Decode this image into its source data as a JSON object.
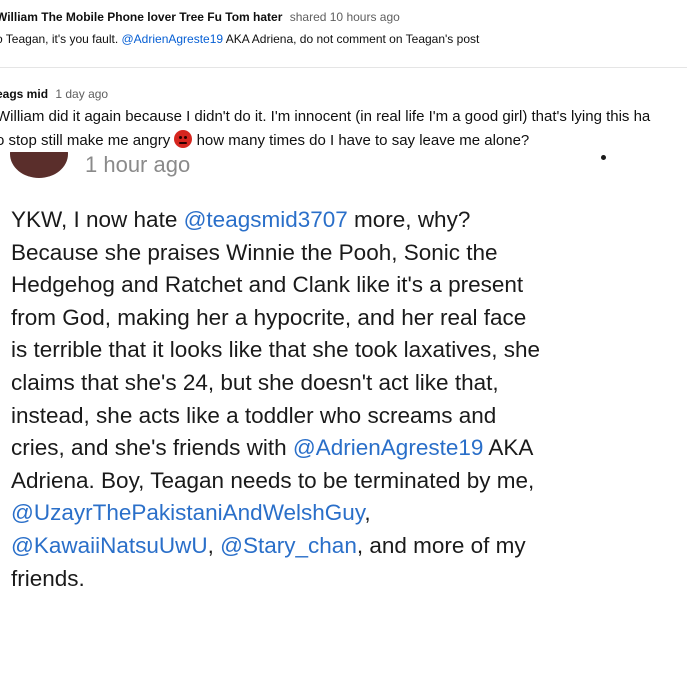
{
  "post": {
    "author": "William The Mobile Phone lover Tree Fu Tom hater",
    "meta": "shared 10 hours ago",
    "text_before": "o Teagan, it's you fault.",
    "mention": "@AdrienAgreste19",
    "text_after": "AKA Adriena, do not comment on Teagan's post"
  },
  "reply": {
    "author": "eags mid",
    "time": "1 day ago",
    "line1": "William did it again because I didn't do it. I'm innocent (in real life I'm a good girl) that's lying this ha",
    "line2_before": "o stop still make me angry",
    "emoji_name": "angry-face-emoji",
    "line2_after": "how many times do I have to say leave me alone?"
  },
  "screenshot": {
    "timestamp": "1 hour ago",
    "lines": [
      {
        "t1": "YKW, I now hate ",
        "m1": "@teagsmid3707",
        "t2": " more, why?"
      },
      {
        "t1": "Because she praises Winnie the Pooh, Sonic the"
      },
      {
        "t1": "Hedgehog and Ratchet and Clank like it's a present"
      },
      {
        "t1": "from God, making her a hypocrite, and her real face"
      },
      {
        "t1": "is terrible that it looks like that she took laxatives, she"
      },
      {
        "t1": "claims that she's 24, but she doesn't act like that,"
      },
      {
        "t1": "instead, she acts like a toddler who screams and"
      },
      {
        "t1": "cries, and she's friends with ",
        "m1": "@AdrienAgreste19",
        "t2": " AKA"
      },
      {
        "t1": "Adriena. Boy, Teagan needs to be terminated by me,"
      },
      {
        "m1": "@UzayrThePakistaniAndWelshGuy",
        "t2": ","
      },
      {
        "m1": "@KawaiiNatsuUwU",
        "t2": ", ",
        "m2": "@Stary_chan",
        "t3": ", and more of my"
      },
      {
        "t1": "friends."
      }
    ]
  }
}
